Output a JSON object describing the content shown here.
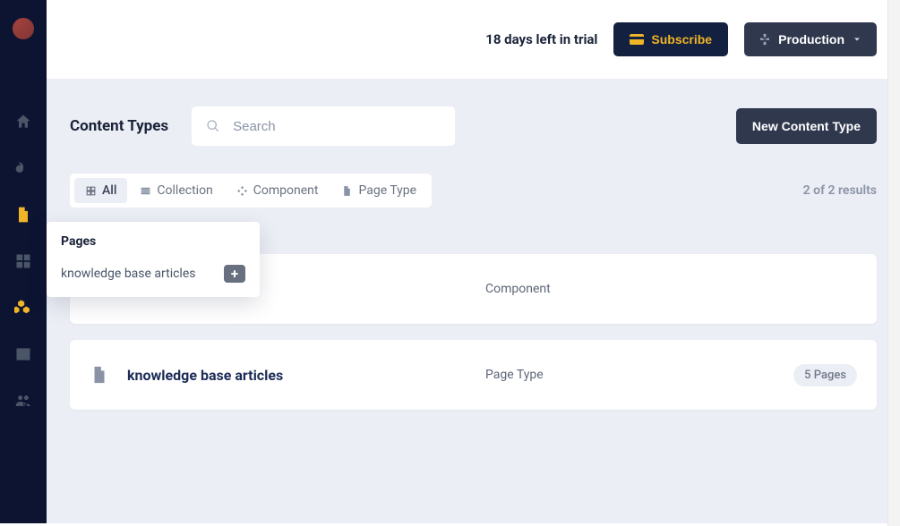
{
  "topbar": {
    "trial_text": "18 days left in trial",
    "subscribe_label": "Subscribe",
    "production_label": "Production"
  },
  "page": {
    "title": "Content Types",
    "search_placeholder": "Search",
    "new_button_label": "New Content Type",
    "results_count": "2 of 2 results"
  },
  "filters": {
    "all": "All",
    "collection": "Collection",
    "component": "Component",
    "page_type": "Page Type"
  },
  "rows": [
    {
      "title": "",
      "type": "Component",
      "badge": ""
    },
    {
      "title": "knowledge base articles",
      "type": "Page Type",
      "badge": "5 Pages"
    }
  ],
  "popover": {
    "title": "Pages",
    "item": "knowledge base articles"
  }
}
